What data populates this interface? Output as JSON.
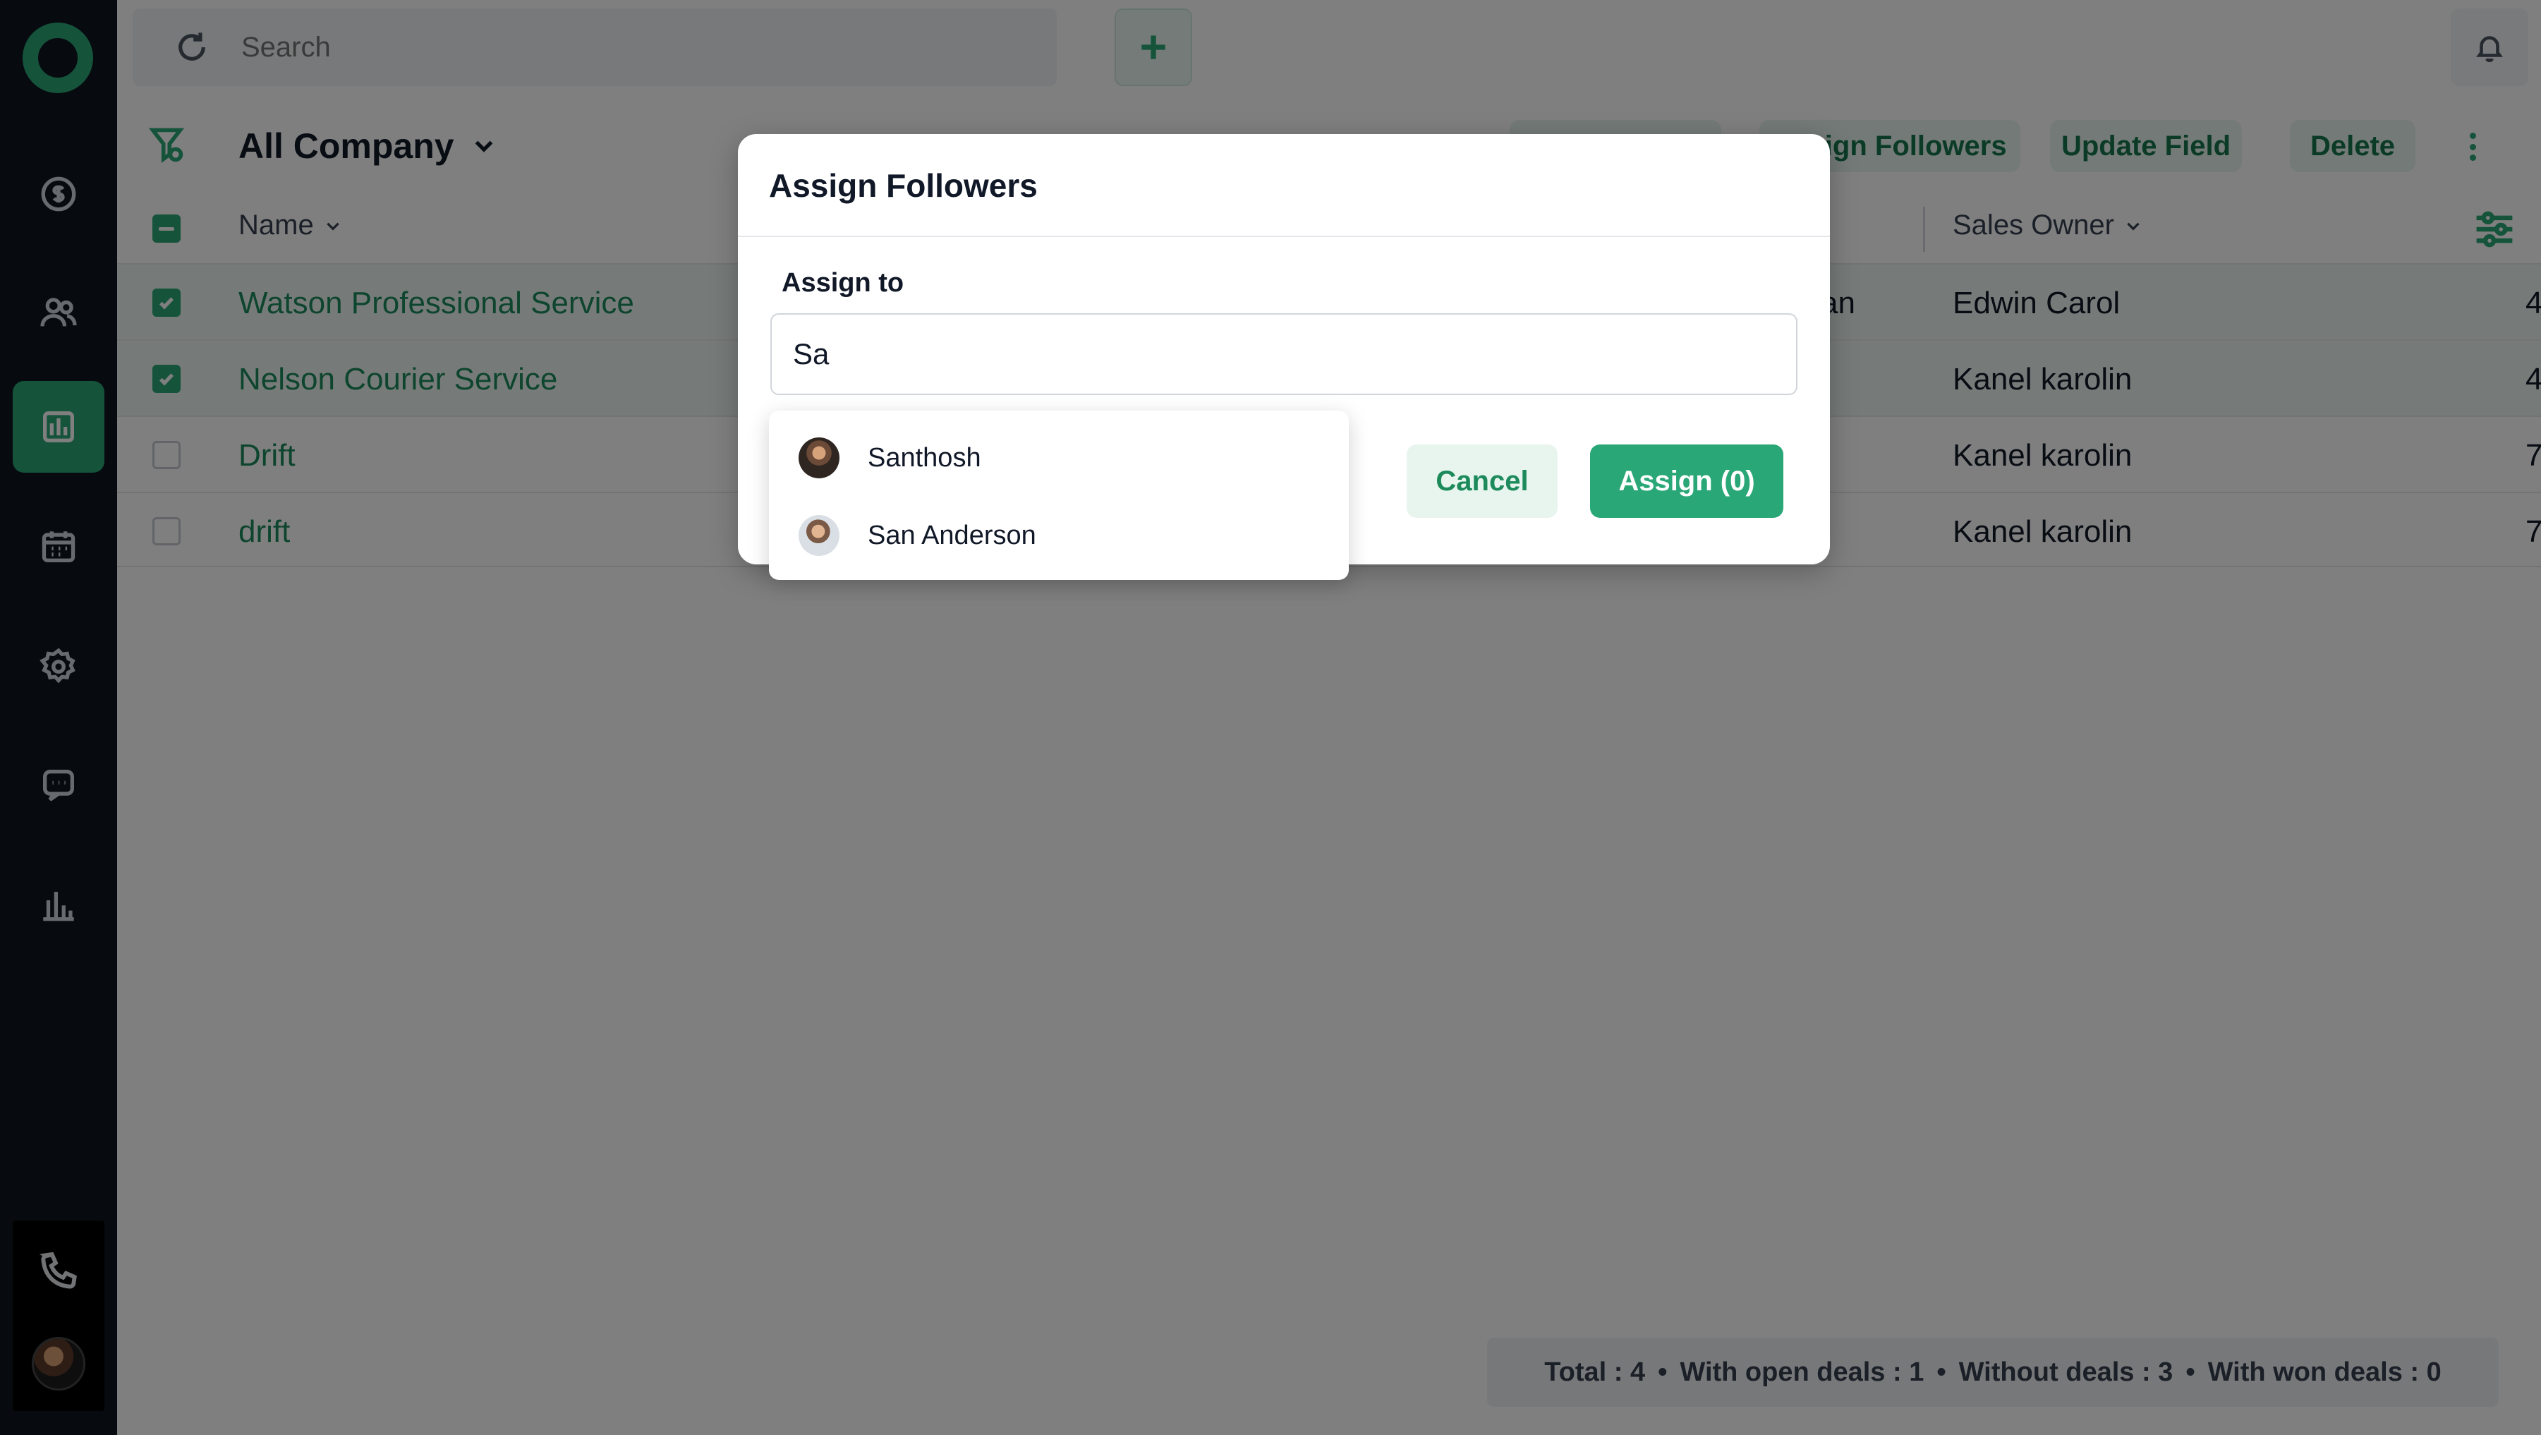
{
  "search": {
    "placeholder": "Search"
  },
  "toolbar": {
    "view_title": "All Company",
    "actions": [
      {
        "label": "Assign Followers"
      },
      {
        "label": "Update Field"
      },
      {
        "label": "Delete"
      }
    ]
  },
  "table": {
    "columns": {
      "name": "Name",
      "sales_owner": "Sales Owner"
    },
    "rows": [
      {
        "name": "Watson Professional Service",
        "partial": "an",
        "owner": "Edwin Carol",
        "num": "4",
        "checked": true
      },
      {
        "name": "Nelson Courier Service",
        "partial": "",
        "owner": "Kanel karolin",
        "num": "4",
        "checked": true
      },
      {
        "name": "Drift",
        "partial": "",
        "owner": "Kanel karolin",
        "num": "7",
        "checked": false
      },
      {
        "name": "drift",
        "partial": "",
        "owner": "Kanel karolin",
        "num": "7",
        "checked": false
      }
    ]
  },
  "summary": {
    "total": "Total : 4",
    "open": "With open deals : 1",
    "without": "Without deals : 3",
    "won": "With won deals : 0"
  },
  "modal": {
    "title": "Assign Followers",
    "assign_label": "Assign to",
    "input_value": "Sa",
    "cancel_label": "Cancel",
    "assign_label_btn": "Assign (0)",
    "suggestions": [
      {
        "name": "Santhosh"
      },
      {
        "name": "San Anderson"
      }
    ]
  },
  "colors": {
    "accent": "#2aa777",
    "sidebar": "#0f1720",
    "link": "#1d8a5c"
  },
  "icons": {
    "sidebar": [
      "deals-icon",
      "contacts-icon",
      "accounts-icon",
      "calendar-icon",
      "settings-icon",
      "chat-icon",
      "reports-icon"
    ],
    "bottom": [
      "phone-icon"
    ]
  }
}
